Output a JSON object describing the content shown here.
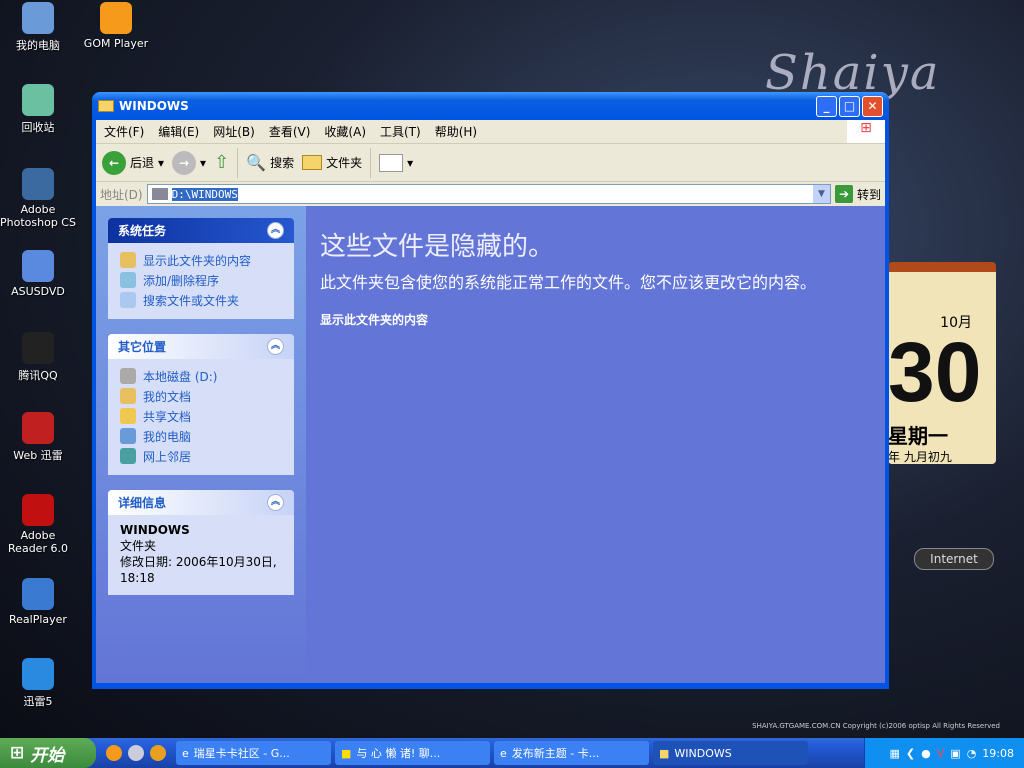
{
  "desktop": {
    "icons": [
      {
        "label": "我的电脑",
        "color": "#6a9ad8"
      },
      {
        "label": "GOM Player",
        "color": "#f59a1a"
      },
      {
        "label": "回收站",
        "color": "#6ac0a0"
      },
      {
        "label": "Adobe Photoshop CS",
        "color": "#3a6aa0"
      },
      {
        "label": "ASUSDVD",
        "color": "#5a8ae0"
      },
      {
        "label": "腾讯QQ",
        "color": "#222"
      },
      {
        "label": "Web 迅雷",
        "color": "#c02020"
      },
      {
        "label": "Adobe Reader 6.0",
        "color": "#c01010"
      },
      {
        "label": "RealPlayer",
        "color": "#3a7ad0"
      },
      {
        "label": "迅雷5",
        "color": "#2a8ae0"
      }
    ],
    "logo": "Shaiya",
    "calendar": {
      "month": "10月",
      "day": "30",
      "weekday": "星期一",
      "lunar": "年  九月初九"
    },
    "internet_button": "Internet",
    "copyright": "SHAIYA.GTGAME.COM.CN Copyright (c)2006 optisp All Rights Reserved"
  },
  "window": {
    "title": "WINDOWS",
    "menu": [
      "文件(F)",
      "编辑(E)",
      "网址(B)",
      "查看(V)",
      "收藏(A)",
      "工具(T)",
      "帮助(H)"
    ],
    "toolbar": {
      "back": "后退",
      "search": "搜索",
      "folders": "文件夹"
    },
    "address": {
      "label": "地址(D)",
      "value": "D:\\WINDOWS",
      "go": "转到"
    },
    "panels": {
      "tasks": {
        "title": "系统任务",
        "items": [
          "显示此文件夹的内容",
          "添加/删除程序",
          "搜索文件或文件夹"
        ]
      },
      "places": {
        "title": "其它位置",
        "items": [
          "本地磁盘 (D:)",
          "我的文档",
          "共享文档",
          "我的电脑",
          "网上邻居"
        ]
      },
      "details": {
        "title": "详细信息",
        "name": "WINDOWS",
        "type": "文件夹",
        "modified": "修改日期: 2006年10月30日, 18:18"
      }
    },
    "main": {
      "heading": "这些文件是隐藏的。",
      "text": "此文件夹包含使您的系统能正常工作的文件。您不应该更改它的内容。",
      "link": "显示此文件夹的内容"
    }
  },
  "taskbar": {
    "start": "开始",
    "tasks": [
      "瑞星卡卡社区 - G...",
      "与 心 懒 诸! 聊...",
      "发布新主题 - 卡...",
      "WINDOWS"
    ],
    "clock": "19:08"
  }
}
